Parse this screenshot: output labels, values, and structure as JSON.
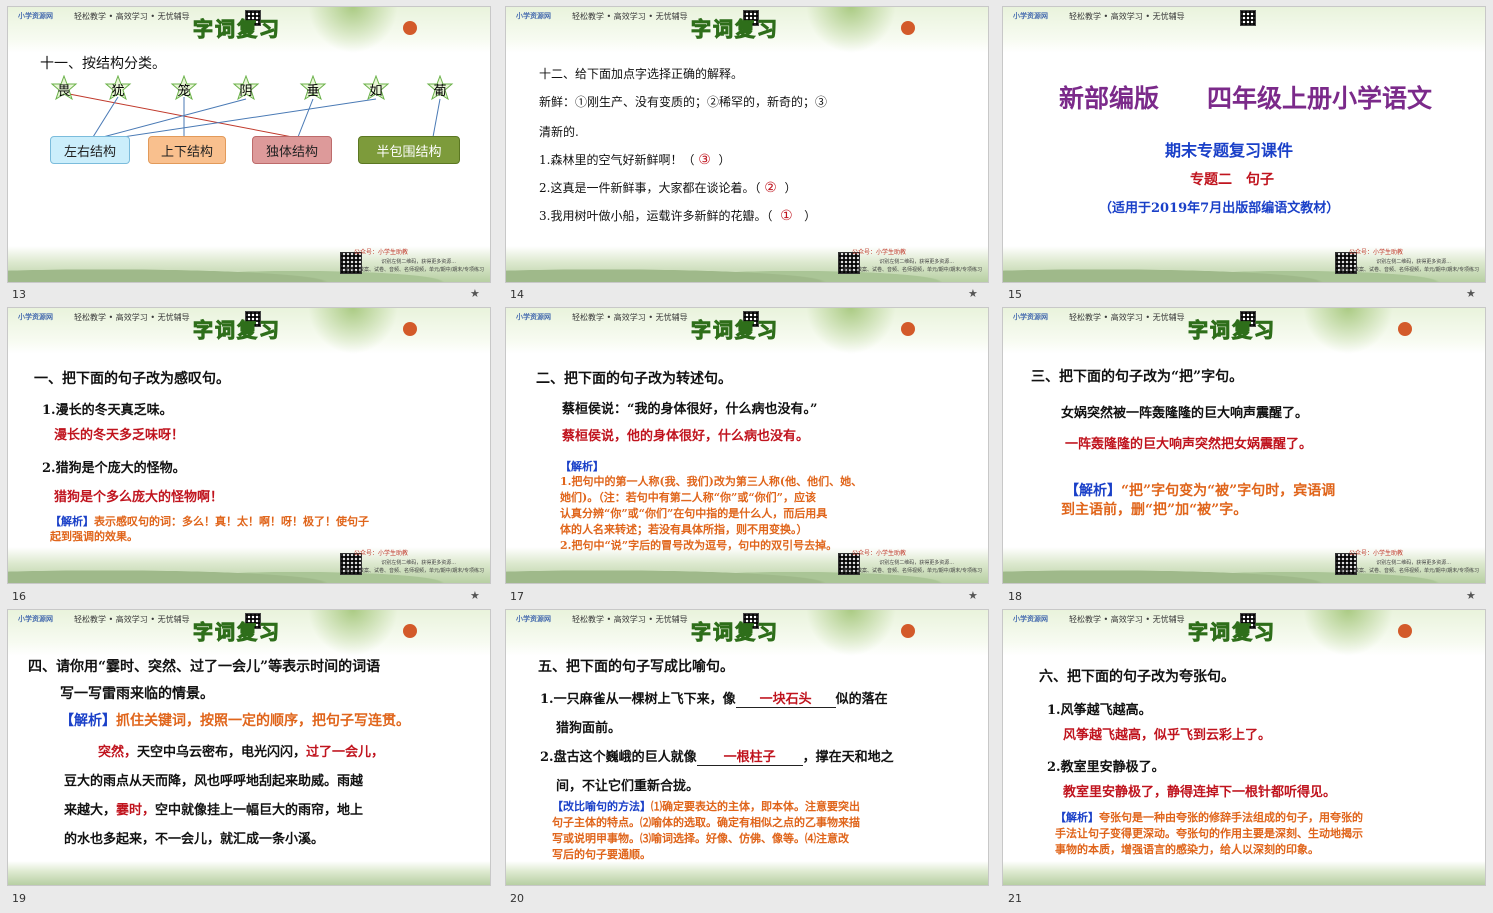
{
  "common": {
    "logo": "小学资源网",
    "url": "www.xxzy.com",
    "tagline": "轻松教学 • 高效学习 • 无忧辅导",
    "subline": "专注于小学最新最全的教学资源",
    "banner": "字词复习",
    "gongzhonghao": "公众号：小学生助教",
    "footer_line1": "识别左侧二维码，获得更多资源...",
    "footer_line2": "课件、教案、试卷、音频、名师视频，单元/期中/期末/专项练习",
    "star": "★"
  },
  "slides": [
    {
      "num": "13",
      "title": "十一、按结构分类。",
      "chars": [
        "畏",
        "犹",
        "笼",
        "阴",
        "垂",
        "如",
        "葡"
      ],
      "boxes": [
        "左右结构",
        "上下结构",
        "独体结构",
        "半包围结构"
      ]
    },
    {
      "num": "14",
      "title": "十二、给下面加点字选择正确的解释。",
      "def_a": "新鲜：①刚生产、没有变质的；②稀罕的，新奇的；③",
      "def_b": "清新的.",
      "q1": "1.森林里的空气好新鲜啊！（",
      "a1": "③",
      "q2": "2.这真是一件新鲜事，大家都在谈论着。（",
      "a2": "②",
      "q3": "3.我用树叶做小船，运载许多新鲜的花瓣。（",
      "a3": "①",
      "close": "）"
    },
    {
      "num": "15",
      "title1": "新部编版",
      "title2": "四年级上册小学语文",
      "subtitle": "期末专题复习课件",
      "topic": "专题二　句子",
      "note": "（适用于2019年7月出版部编语文教材）"
    },
    {
      "num": "16",
      "title": "一、把下面的句子改为感叹句。",
      "q1": "1.漫长的冬天真乏味。",
      "a1": "漫长的冬天多乏味呀！",
      "q2": "2.猎狗是个庞大的怪物。",
      "a2": "猎狗是个多么庞大的怪物啊！",
      "ana_tag": "【解析】",
      "ana1": "表示感叹句的词：多么！真！太！啊！呀！极了！使句子",
      "ana2": "起到强调的效果。"
    },
    {
      "num": "17",
      "title": "二、把下面的句子改为转述句。",
      "q": "蔡桓侯说：“我的身体很好，什么病也没有。”",
      "a": "蔡桓侯说，他的身体很好，什么病也没有。",
      "ana_tag": "【解析】",
      "ana": [
        "1.把句中的第一人称(我、我们)改为第三人称(他、他们、她、",
        "  她们)。（注：若句中有第二人称“你”或“你们”，应该",
        "  认真分辨“你”或“你们”在句中指的是什么人，而后用具",
        "  体的人名来转述；若没有具体所指，则不用变换。）",
        "2.把句中“说”字后的冒号改为逗号，句中的双引号去掉。"
      ]
    },
    {
      "num": "18",
      "title": "三、把下面的句子改为“把”字句。",
      "q": "女娲突然被一阵轰隆隆的巨大响声震醒了。",
      "a": "一阵轰隆隆的巨大响声突然把女娲震醒了。",
      "ana_tag": "【解析】",
      "ana1": "“把”字句变为“被”字句时，宾语调",
      "ana2": "到主语前，删“把”加“被”字。"
    },
    {
      "num": "19",
      "title1": "四、请你用“霎时、突然、过了一会儿”等表示时间的词语",
      "title2": "写一写雷雨来临的情景。",
      "ana_tag": "【解析】",
      "ana": "抓住关键词，按照一定的顺序，把句子写连贯。",
      "p1_k1": "突然，",
      "p1_r1": "天空中乌云密布，电光闪闪，",
      "p1_k2": "过了一会儿，",
      "p2": "豆大的雨点从天而降，风也呼呼地刮起来助威。雨越",
      "p3_r1": "来越大，",
      "p3_k": "霎时，",
      "p3_r2": "空中就像挂上一幅巨大的雨帘，地上",
      "p4": "的水也多起来，不一会儿，就汇成一条小溪。"
    },
    {
      "num": "20",
      "title": "五、把下面的句子写成比喻句。",
      "q1a": "1.一只麻雀从一棵树上飞下来，像",
      "q1ans": "一块石头",
      "q1b": "似的落在",
      "q1c": "猎狗面前。",
      "q2a": "2.盘古这个巍峨的巨人就像",
      "q2ans": "一根柱子",
      "q2b": "，撑在天和地之",
      "q2c": "间，不让它们重新合拢。",
      "ana_tag": "【改比喻句的方法】",
      "ana": [
        "⑴确定要表达的主体，即本体。注意要突出",
        "句子主体的特点。⑵喻体的选取。确定有相似之点的乙事物来描",
        "写或说明甲事物。⑶喻词选择。好像、仿佛、像等。⑷注意改",
        "写后的句子要通顺。"
      ]
    },
    {
      "num": "21",
      "title": "六、把下面的句子改为夸张句。",
      "q1": "1.风筝越飞越高。",
      "a1": "风筝越飞越高，似乎飞到云彩上了。",
      "q2": "2.教室里安静极了。",
      "a2": "教室里安静极了，静得连掉下一根针都听得见。",
      "ana_tag": "【解析】",
      "ana": [
        "夸张句是一种由夸张的修辞手法组成的句子，用夸张的",
        "手法让句子变得更深动。夸张句的作用主要是深刻、生动地揭示",
        "事物的本质，增强语言的感染力，给人以深刻的印象。"
      ]
    }
  ]
}
